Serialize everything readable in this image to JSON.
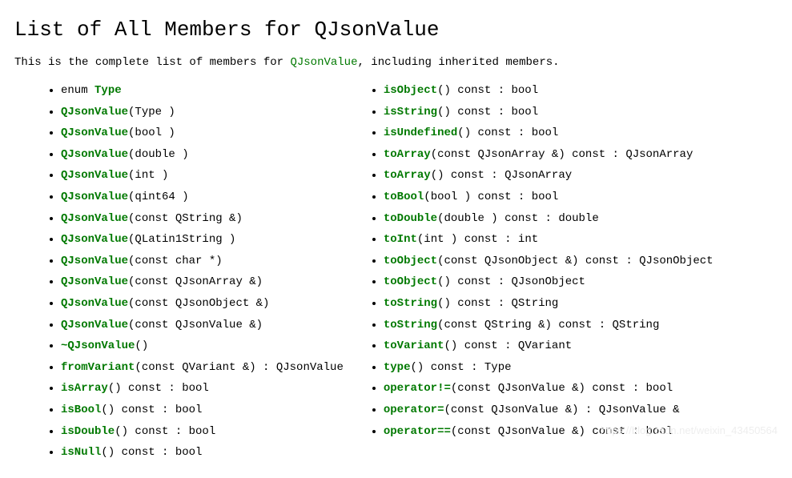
{
  "title": "List of All Members for QJsonValue",
  "intro_prefix": "This is the complete list of members for ",
  "intro_link": "QJsonValue",
  "intro_suffix": ", including inherited members.",
  "left": [
    {
      "prefix": "enum ",
      "name": "Type",
      "suffix": ""
    },
    {
      "prefix": "",
      "name": "QJsonValue",
      "suffix": "(Type )"
    },
    {
      "prefix": "",
      "name": "QJsonValue",
      "suffix": "(bool )"
    },
    {
      "prefix": "",
      "name": "QJsonValue",
      "suffix": "(double )"
    },
    {
      "prefix": "",
      "name": "QJsonValue",
      "suffix": "(int )"
    },
    {
      "prefix": "",
      "name": "QJsonValue",
      "suffix": "(qint64 )"
    },
    {
      "prefix": "",
      "name": "QJsonValue",
      "suffix": "(const QString &)"
    },
    {
      "prefix": "",
      "name": "QJsonValue",
      "suffix": "(QLatin1String )"
    },
    {
      "prefix": "",
      "name": "QJsonValue",
      "suffix": "(const char *)"
    },
    {
      "prefix": "",
      "name": "QJsonValue",
      "suffix": "(const QJsonArray &)"
    },
    {
      "prefix": "",
      "name": "QJsonValue",
      "suffix": "(const QJsonObject &)"
    },
    {
      "prefix": "",
      "name": "QJsonValue",
      "suffix": "(const QJsonValue &)"
    },
    {
      "prefix": "",
      "name": "~QJsonValue",
      "suffix": "()"
    },
    {
      "prefix": "",
      "name": "fromVariant",
      "suffix": "(const QVariant &) : QJsonValue"
    },
    {
      "prefix": "",
      "name": "isArray",
      "suffix": "() const : bool"
    },
    {
      "prefix": "",
      "name": "isBool",
      "suffix": "() const : bool"
    },
    {
      "prefix": "",
      "name": "isDouble",
      "suffix": "() const : bool"
    },
    {
      "prefix": "",
      "name": "isNull",
      "suffix": "() const : bool"
    }
  ],
  "right": [
    {
      "prefix": "",
      "name": "isObject",
      "suffix": "() const : bool"
    },
    {
      "prefix": "",
      "name": "isString",
      "suffix": "() const : bool"
    },
    {
      "prefix": "",
      "name": "isUndefined",
      "suffix": "() const : bool"
    },
    {
      "prefix": "",
      "name": "toArray",
      "suffix": "(const QJsonArray &) const : QJsonArray"
    },
    {
      "prefix": "",
      "name": "toArray",
      "suffix": "() const : QJsonArray"
    },
    {
      "prefix": "",
      "name": "toBool",
      "suffix": "(bool ) const : bool"
    },
    {
      "prefix": "",
      "name": "toDouble",
      "suffix": "(double ) const : double"
    },
    {
      "prefix": "",
      "name": "toInt",
      "suffix": "(int ) const : int"
    },
    {
      "prefix": "",
      "name": "toObject",
      "suffix": "(const QJsonObject &) const : QJsonObject"
    },
    {
      "prefix": "",
      "name": "toObject",
      "suffix": "() const : QJsonObject"
    },
    {
      "prefix": "",
      "name": "toString",
      "suffix": "() const : QString"
    },
    {
      "prefix": "",
      "name": "toString",
      "suffix": "(const QString &) const : QString"
    },
    {
      "prefix": "",
      "name": "toVariant",
      "suffix": "() const : QVariant"
    },
    {
      "prefix": "",
      "name": "type",
      "suffix": "() const : Type"
    },
    {
      "prefix": "",
      "name": "operator!=",
      "suffix": "(const QJsonValue &) const : bool"
    },
    {
      "prefix": "",
      "name": "operator=",
      "suffix": "(const QJsonValue &) : QJsonValue &"
    },
    {
      "prefix": "",
      "name": "operator==",
      "suffix": "(const QJsonValue &) const : bool"
    }
  ],
  "watermark": "https://blog.csdn.net/weixin_43450564"
}
